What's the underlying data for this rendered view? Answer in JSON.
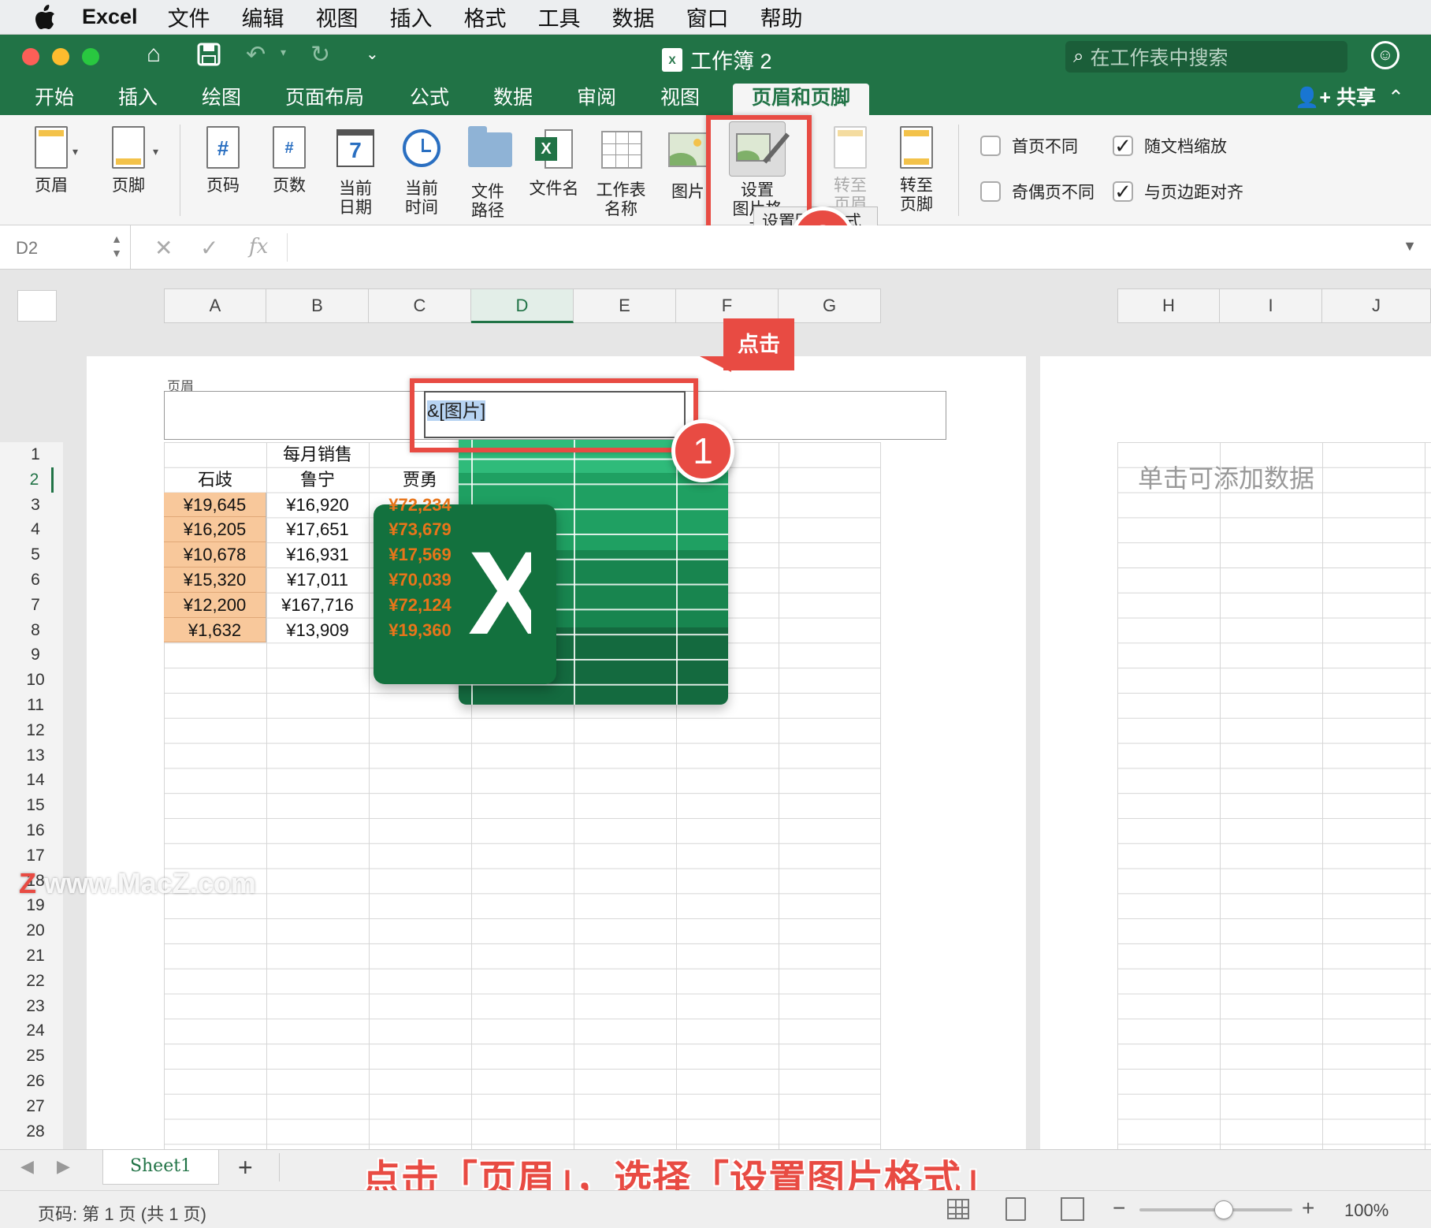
{
  "menubar": {
    "app_name": "Excel",
    "items": [
      "文件",
      "编辑",
      "视图",
      "插入",
      "格式",
      "工具",
      "数据",
      "窗口",
      "帮助"
    ]
  },
  "titlebar": {
    "doc_title": "工作簿 2",
    "search_placeholder": "在工作表中搜索"
  },
  "ribbon_tabs": {
    "tabs": [
      "开始",
      "插入",
      "绘图",
      "页面布局",
      "公式",
      "数据",
      "审阅",
      "视图",
      "页眉和页脚"
    ],
    "active": "页眉和页脚",
    "share": "共享"
  },
  "ribbon": {
    "header": "页眉",
    "footer": "页脚",
    "page_number": "页码",
    "page_count": "页数",
    "current_date_1": "当前",
    "current_date_2": "日期",
    "current_time_1": "当前",
    "current_time_2": "时间",
    "file_path_1": "文件",
    "file_path_2": "路径",
    "file_name": "文件名",
    "sheet_name_1": "工作表",
    "sheet_name_2": "名称",
    "picture": "图片",
    "format_picture_1": "设置",
    "format_picture_2": "图片格式",
    "goto_header_1": "转至",
    "goto_header_2": "页眉",
    "goto_footer_1": "转至",
    "goto_footer_2": "页脚",
    "calendar_day": "7",
    "options": {
      "different_first": "首页不同",
      "different_odd_even": "奇偶页不同",
      "scale_with_doc": "随文档缩放",
      "align_margins": "与页边距对齐"
    },
    "tooltip": "设置图片格式"
  },
  "formula_bar": {
    "name_box": "D2",
    "fx": "fx"
  },
  "columns": [
    "A",
    "B",
    "C",
    "D",
    "E",
    "F",
    "G",
    "H",
    "I",
    "J"
  ],
  "rows": [
    "1",
    "2",
    "3",
    "4",
    "5",
    "6",
    "7",
    "8",
    "9",
    "10",
    "11",
    "12",
    "13",
    "14",
    "15",
    "16",
    "17",
    "18",
    "19",
    "20",
    "21",
    "22",
    "23",
    "24",
    "25",
    "26",
    "27",
    "28"
  ],
  "header_area": {
    "label": "页眉",
    "field_value": "&[图片]"
  },
  "right_page_hint": "单击可添加数据",
  "table": {
    "title": "每月销售",
    "headers": [
      "石歧",
      "鲁宁",
      "贾勇"
    ],
    "rows": [
      [
        "¥19,645",
        "¥16,920",
        "¥72,234"
      ],
      [
        "¥16,205",
        "¥17,651",
        "¥73,679"
      ],
      [
        "¥10,678",
        "¥16,931",
        "¥17,569"
      ],
      [
        "¥15,320",
        "¥17,011",
        "¥70,039"
      ],
      [
        "¥12,200",
        "¥167,716",
        "¥72,124"
      ],
      [
        "¥1,632",
        "¥13,909",
        "¥19,360"
      ]
    ]
  },
  "annotations": {
    "step1": "1",
    "step2": "2",
    "click_label": "点击",
    "caption": "点击「页眉」，选择「设置图片格式」",
    "watermark": "www.MacZ.com"
  },
  "sheet_tabs": {
    "sheet1": "Sheet1",
    "add": "+"
  },
  "status": {
    "page_info": "页码: 第 1 页 (共 1 页)",
    "zoom": "100%",
    "zoom_fraction": 0.55
  },
  "colors": {
    "excel_green": "#217346",
    "annotation_red": "#e84b43",
    "highlight_orange": "#f8c89b",
    "value_orange": "#e8751a"
  }
}
